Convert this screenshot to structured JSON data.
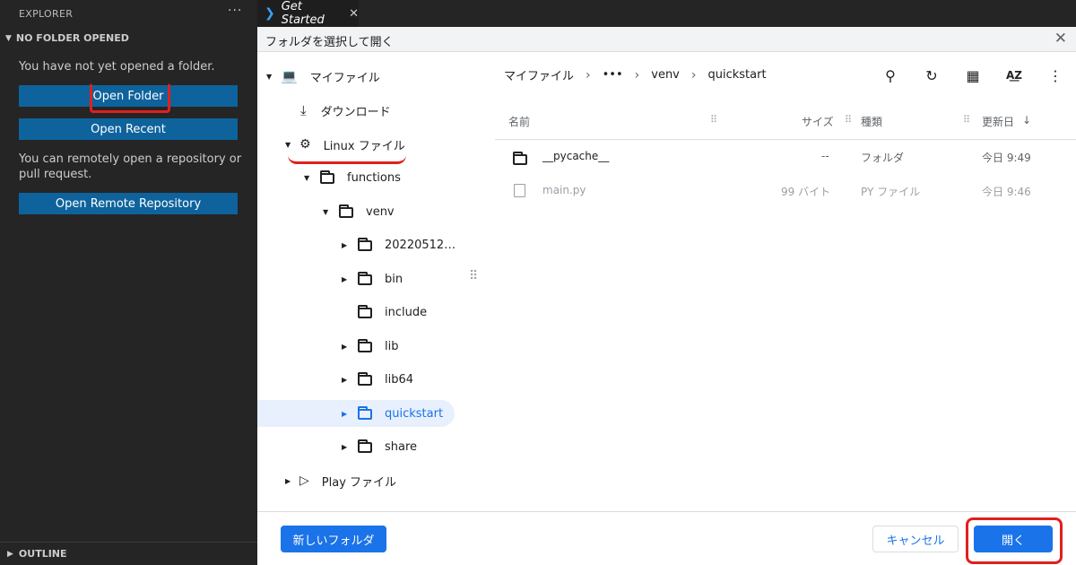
{
  "sidebar": {
    "header": "EXPLORER",
    "more": "···",
    "section": "NO FOLDER OPENED",
    "no_folder_text": "You have not yet opened a folder.",
    "open_folder": "Open Folder",
    "open_recent": "Open Recent",
    "remote_text": "You can remotely open a repository or pull request.",
    "open_remote": "Open Remote Repository",
    "outline": "OUTLINE"
  },
  "editor": {
    "tab_label": "Get Started",
    "tab_close": "✕"
  },
  "dialog": {
    "title": "フォルダを選択して開く",
    "close": "✕",
    "tree": [
      {
        "label": "マイファイル",
        "icon": "laptop-icon"
      },
      {
        "label": "ダウンロード",
        "icon": "download-icon"
      },
      {
        "label": "Linux ファイル",
        "icon": "linux-icon"
      },
      {
        "label": "functions",
        "icon": "folder-icon"
      },
      {
        "label": "venv",
        "icon": "folder-icon"
      },
      {
        "label": "20220512…",
        "icon": "folder-icon"
      },
      {
        "label": "bin",
        "icon": "folder-icon"
      },
      {
        "label": "include",
        "icon": "folder-icon"
      },
      {
        "label": "lib",
        "icon": "folder-icon"
      },
      {
        "label": "lib64",
        "icon": "folder-icon"
      },
      {
        "label": "quickstart",
        "icon": "folder-icon",
        "selected": true
      },
      {
        "label": "share",
        "icon": "folder-icon"
      },
      {
        "label": "Play ファイル",
        "icon": "play-store-icon"
      }
    ],
    "breadcrumb": [
      "マイファイル",
      "•••",
      "venv",
      "quickstart"
    ],
    "columns": {
      "name": "名前",
      "size": "サイズ",
      "type": "種類",
      "modified": "更新日"
    },
    "files": [
      {
        "name": "__pycache__",
        "size": "--",
        "type": "フォルダ",
        "modified": "今日 9:49",
        "icon": "folder-icon"
      },
      {
        "name": "main.py",
        "size": "99 バイト",
        "type": "PY ファイル",
        "modified": "今日 9:46",
        "icon": "file-icon"
      }
    ],
    "new_folder": "新しいフォルダ",
    "cancel": "キャンセル",
    "open": "開く"
  },
  "colors": {
    "vscode_button": "#0e639c",
    "dialog_accent": "#1a73e8",
    "annotation_red": "#e0201e"
  }
}
